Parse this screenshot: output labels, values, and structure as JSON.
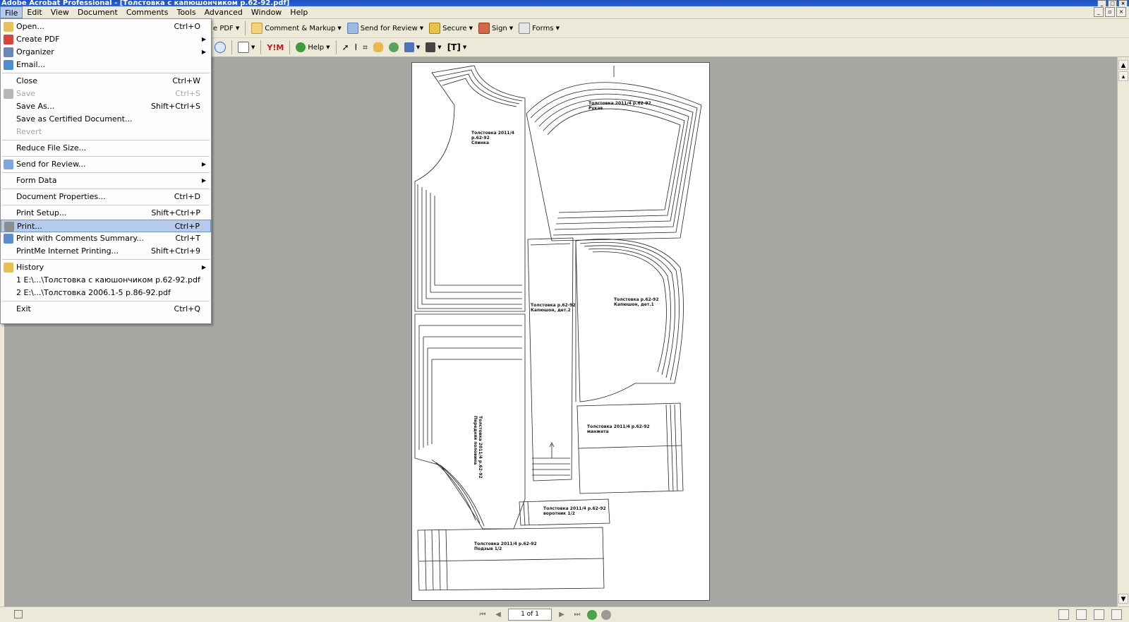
{
  "app": {
    "title": "Adobe Acrobat Professional - [Толстовка с капюшончиком р.62-92.pdf]"
  },
  "menubar": [
    "File",
    "Edit",
    "View",
    "Document",
    "Comments",
    "Tools",
    "Advanced",
    "Window",
    "Help"
  ],
  "toolbar1": {
    "create_pdf": "e PDF",
    "comment_markup": "Comment & Markup",
    "send_for_review": "Send for Review",
    "secure": "Secure",
    "sign": "Sign",
    "forms": "Forms"
  },
  "toolbar2": {
    "help": "Help"
  },
  "file_menu": {
    "items": [
      {
        "label": "Open...",
        "shortcut": "Ctrl+O",
        "icon": "open-folder-icon",
        "arrow": false,
        "disabled": false,
        "selected": false
      },
      {
        "label": "Create PDF",
        "shortcut": "",
        "icon": "create-pdf-icon",
        "arrow": true,
        "disabled": false,
        "selected": false
      },
      {
        "label": "Organizer",
        "shortcut": "",
        "icon": "organizer-icon",
        "arrow": true,
        "disabled": false,
        "selected": false
      },
      {
        "label": "Email...",
        "shortcut": "",
        "icon": "email-icon",
        "arrow": false,
        "disabled": false,
        "selected": false
      },
      {
        "label": "Close",
        "shortcut": "Ctrl+W",
        "icon": "",
        "arrow": false,
        "disabled": false,
        "selected": false
      },
      {
        "label": "Save",
        "shortcut": "Ctrl+S",
        "icon": "save-icon",
        "arrow": false,
        "disabled": true,
        "selected": false
      },
      {
        "label": "Save As...",
        "shortcut": "Shift+Ctrl+S",
        "icon": "",
        "arrow": false,
        "disabled": false,
        "selected": false
      },
      {
        "label": "Save as Certified Document...",
        "shortcut": "",
        "icon": "",
        "arrow": false,
        "disabled": false,
        "selected": false
      },
      {
        "label": "Revert",
        "shortcut": "",
        "icon": "",
        "arrow": false,
        "disabled": true,
        "selected": false
      },
      {
        "label": "Reduce File Size...",
        "shortcut": "",
        "icon": "",
        "arrow": false,
        "disabled": false,
        "selected": false
      },
      {
        "label": "Send for Review...",
        "shortcut": "",
        "icon": "send-review-icon",
        "arrow": true,
        "disabled": false,
        "selected": false
      },
      {
        "label": "Form Data",
        "shortcut": "",
        "icon": "",
        "arrow": true,
        "disabled": false,
        "selected": false
      },
      {
        "label": "Document Properties...",
        "shortcut": "Ctrl+D",
        "icon": "",
        "arrow": false,
        "disabled": false,
        "selected": false
      },
      {
        "label": "Print Setup...",
        "shortcut": "Shift+Ctrl+P",
        "icon": "",
        "arrow": false,
        "disabled": false,
        "selected": false
      },
      {
        "label": "Print...",
        "shortcut": "Ctrl+P",
        "icon": "printer-icon",
        "arrow": false,
        "disabled": false,
        "selected": true
      },
      {
        "label": "Print with Comments Summary...",
        "shortcut": "Ctrl+T",
        "icon": "comments-icon",
        "arrow": false,
        "disabled": false,
        "selected": false
      },
      {
        "label": "PrintMe Internet Printing...",
        "shortcut": "Shift+Ctrl+9",
        "icon": "",
        "arrow": false,
        "disabled": false,
        "selected": false
      },
      {
        "label": "History",
        "shortcut": "",
        "icon": "history-icon",
        "arrow": true,
        "disabled": false,
        "selected": false
      },
      {
        "label": "1 E:\\...\\Толстовка с каюшончиком р.62-92.pdf",
        "shortcut": "",
        "icon": "",
        "arrow": false,
        "disabled": false,
        "selected": false
      },
      {
        "label": "2 E:\\...\\Толстовка 2006.1-5 р.86-92.pdf",
        "shortcut": "",
        "icon": "",
        "arrow": false,
        "disabled": false,
        "selected": false
      },
      {
        "label": "Exit",
        "shortcut": "Ctrl+Q",
        "icon": "",
        "arrow": false,
        "disabled": false,
        "selected": false
      }
    ]
  },
  "document": {
    "labels": {
      "back": "Толстовка 2011/4\nр.62-92\nСпинка",
      "sleeve": "Толстовка 2011/4 р.62-92\nРукав",
      "zip": "Толстовка р.62-92\nКапюшон, дет.2",
      "hood": "Толстовка р.62-92\nКапюшон, дет.1",
      "cuff": "Толстовка 2011/4 р.62-92\nманжета",
      "front": "Толстовка 2011/4 р.62-92\nПередняя половина",
      "collar": "Толстовка 2011/4 р.62-92\nворотник 1/2",
      "waistband": "Толстовка 2011/4 р.62-92\nПодзыв 1/2"
    }
  },
  "status": {
    "page_indicator": "1 of 1"
  },
  "colors": {
    "menu_highlight": "#b6cbeb",
    "chrome": "#ece9d8",
    "workspace": "#a6a6a2",
    "titlebar": "#2a5ccf"
  }
}
